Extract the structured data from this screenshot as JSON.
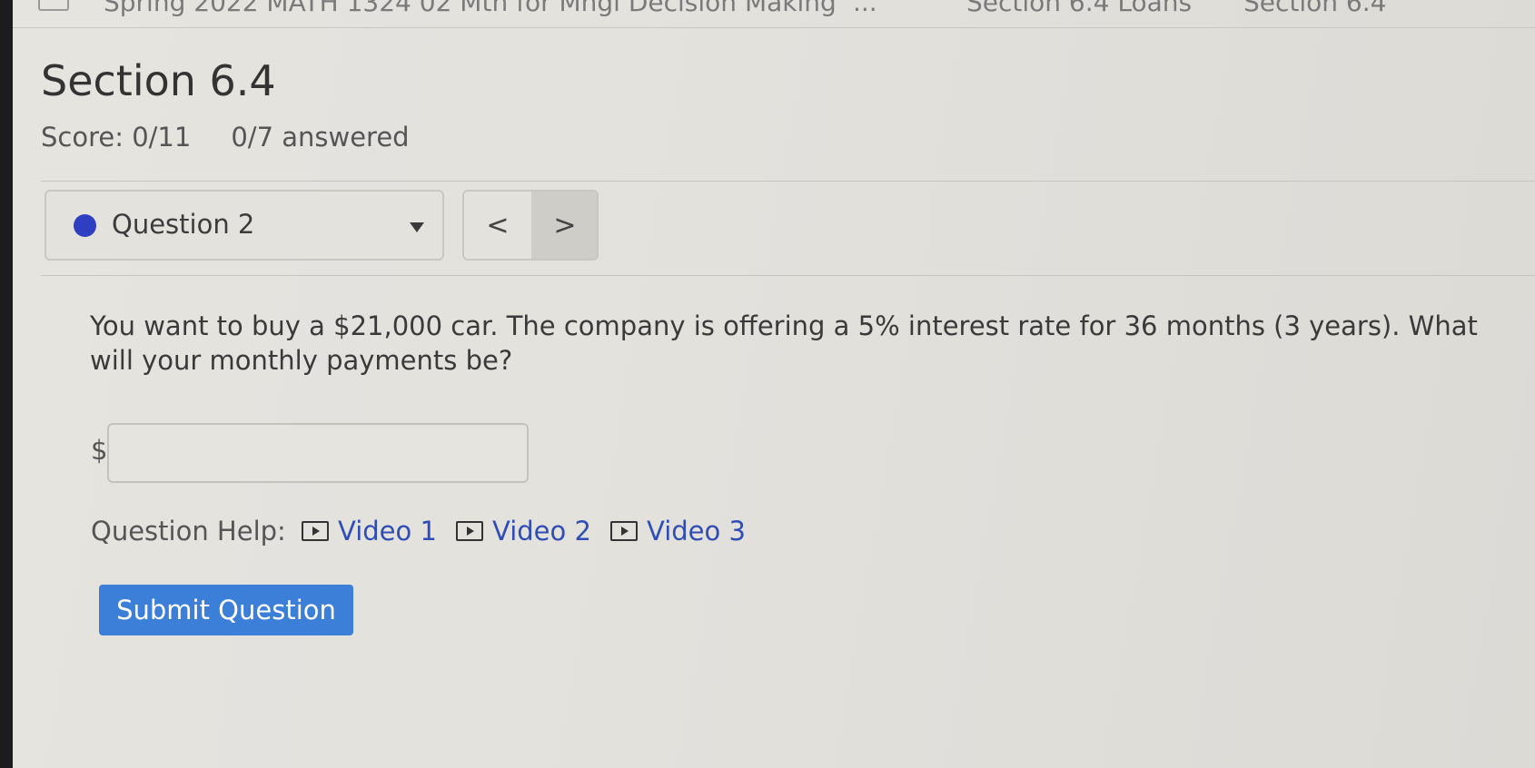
{
  "breadcrumbs": [
    "Spring 2022 MATH 1324 02 Mth for Mngl Decision Making",
    "...",
    "Section 6.4 Loans",
    "Section 6.4"
  ],
  "section": {
    "title": "Section 6.4",
    "score": "Score: 0/11",
    "answered": "0/7 answered"
  },
  "question_nav": {
    "current_label": "Question 2",
    "prev_glyph": "<",
    "next_glyph": ">",
    "status_color": "#2f3fc2"
  },
  "question": {
    "text": "You want to buy a $21,000 car. The company is offering a 5% interest rate for 36 months (3 years). What will your monthly payments be?",
    "currency_symbol": "$",
    "answer_value": ""
  },
  "help": {
    "label": "Question Help:",
    "videos": [
      "Video 1",
      "Video 2",
      "Video 3"
    ]
  },
  "actions": {
    "submit_label": "Submit Question",
    "submit_color": "#3b7fd8"
  }
}
